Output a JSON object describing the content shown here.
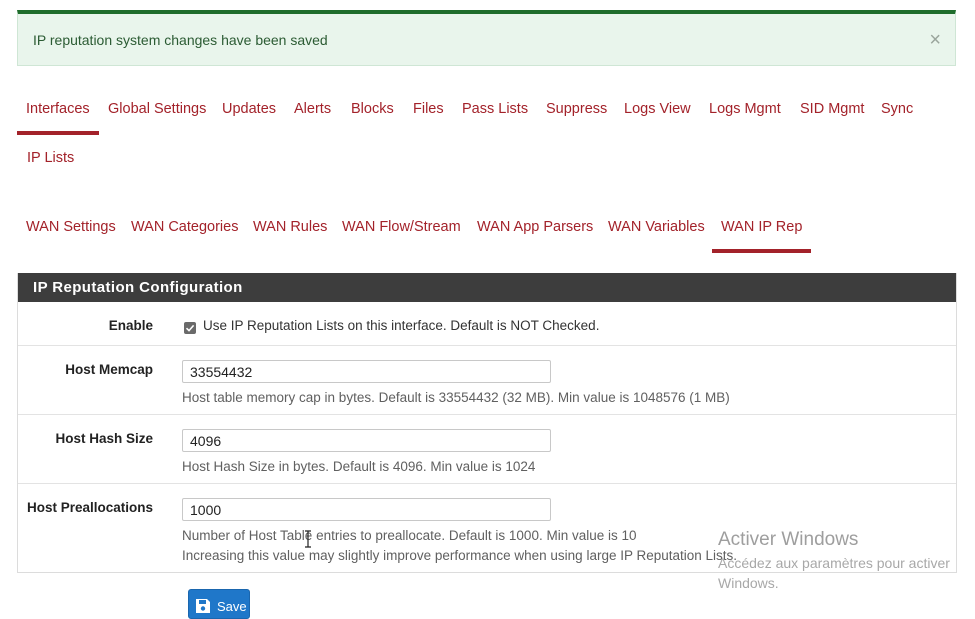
{
  "alert": {
    "message": "IP reputation system changes have been saved",
    "close_glyph": "×"
  },
  "main_tabs": [
    {
      "label": "Interfaces",
      "active": true
    },
    {
      "label": "Global Settings"
    },
    {
      "label": "Updates"
    },
    {
      "label": "Alerts"
    },
    {
      "label": "Blocks"
    },
    {
      "label": "Files"
    },
    {
      "label": "Pass Lists"
    },
    {
      "label": "Suppress"
    },
    {
      "label": "Logs View"
    },
    {
      "label": "Logs Mgmt"
    },
    {
      "label": "SID Mgmt"
    },
    {
      "label": "Sync"
    },
    {
      "label": "IP Lists"
    }
  ],
  "sub_tabs": [
    {
      "label": "WAN Settings"
    },
    {
      "label": "WAN Categories"
    },
    {
      "label": "WAN Rules"
    },
    {
      "label": "WAN Flow/Stream"
    },
    {
      "label": "WAN App Parsers"
    },
    {
      "label": "WAN Variables"
    },
    {
      "label": "WAN IP Rep",
      "active": true
    }
  ],
  "panel": {
    "title": "IP Reputation Configuration",
    "enable": {
      "label": "Enable",
      "checked": true,
      "text": "Use IP Reputation Lists on this interface. Default is NOT Checked."
    },
    "memcap": {
      "label": "Host Memcap",
      "value": "33554432",
      "help": "Host table memory cap in bytes. Default is 33554432 (32 MB). Min value is 1048576 (1 MB)"
    },
    "hashsize": {
      "label": "Host Hash Size",
      "value": "4096",
      "help": "Host Hash Size in bytes. Default is 4096. Min value is 1024"
    },
    "prealloc": {
      "label": "Host Preallocations",
      "value": "1000",
      "help1": "Number of Host Table entries to preallocate. Default is 1000. Min value is 10",
      "help2": "Increasing this value may slightly improve performance when using large IP Reputation Lists."
    }
  },
  "save_label": "Save",
  "watermark": {
    "title": "Activer Windows",
    "subtitle": "Accédez aux paramètres pour activer Windows."
  },
  "colors": {
    "accent": "#a3222a",
    "alert_bg": "#e9f5ec",
    "alert_border": "#1f6d2c",
    "panel_header": "#3d3d3d",
    "button": "#1f77c9"
  }
}
